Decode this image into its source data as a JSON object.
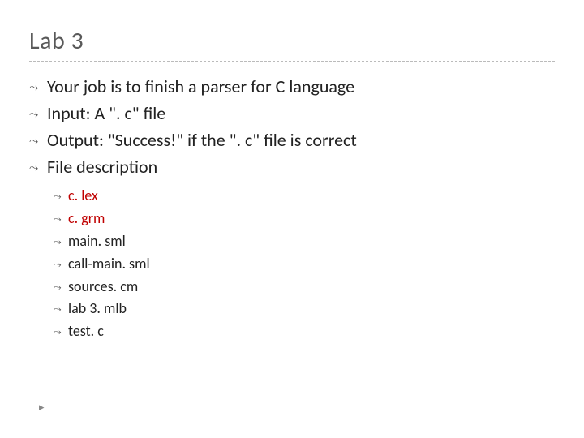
{
  "title": "Lab 3",
  "bullets": [
    {
      "text": "Your job is to finish a parser for C language",
      "red": false
    },
    {
      "text": "Input: A \". c\" file",
      "red": false
    },
    {
      "text": "Output: \"Success!\" if the \". c\" file is correct",
      "red": false
    },
    {
      "text": "File description",
      "red": false
    }
  ],
  "subbullets": [
    {
      "text": "c. lex",
      "red": true
    },
    {
      "text": "c. grm",
      "red": true
    },
    {
      "text": "main. sml",
      "red": false
    },
    {
      "text": "call-main. sml",
      "red": false
    },
    {
      "text": "sources. cm",
      "red": false
    },
    {
      "text": "lab 3. mlb",
      "red": false
    },
    {
      "text": "test. c",
      "red": false
    }
  ],
  "bullet_glyph": "⤳",
  "footer_glyph": "▸"
}
